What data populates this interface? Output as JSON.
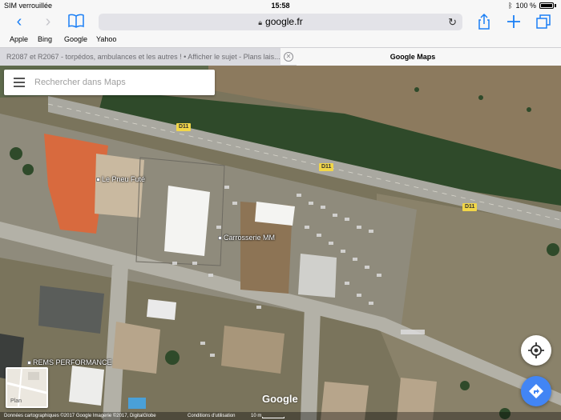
{
  "status_bar": {
    "carrier": "SIM verrouillée",
    "time": "15:58",
    "battery": "100 %"
  },
  "toolbar": {
    "url": "google.fr"
  },
  "bookmarks": [
    "Apple",
    "Bing",
    "Google",
    "Yahoo"
  ],
  "tabs": {
    "inactive": "R2087 et R2067 - torpédos, ambulances et les autres ! • Afficher le sujet - Plans lais...",
    "active": "Google Maps"
  },
  "map": {
    "search_placeholder": "Rechercher dans Maps",
    "pois": [
      "Le Pneu Futé",
      "Carrosserie MM",
      "REMS PERFORMANCE"
    ],
    "road_labels": [
      "D11",
      "D11",
      "D11"
    ],
    "layer_label": "Plan",
    "logo": "Google",
    "footer": {
      "copyright": "Données cartographiques ©2017 Google Imagerie ©2017, DigitalGlobe",
      "terms": "Conditions d'utilisation",
      "scale": "10 m"
    }
  },
  "colors": {
    "accent": "#1a7ff5",
    "directions_fab": "#4285f4",
    "road_label": "#f1d648"
  }
}
